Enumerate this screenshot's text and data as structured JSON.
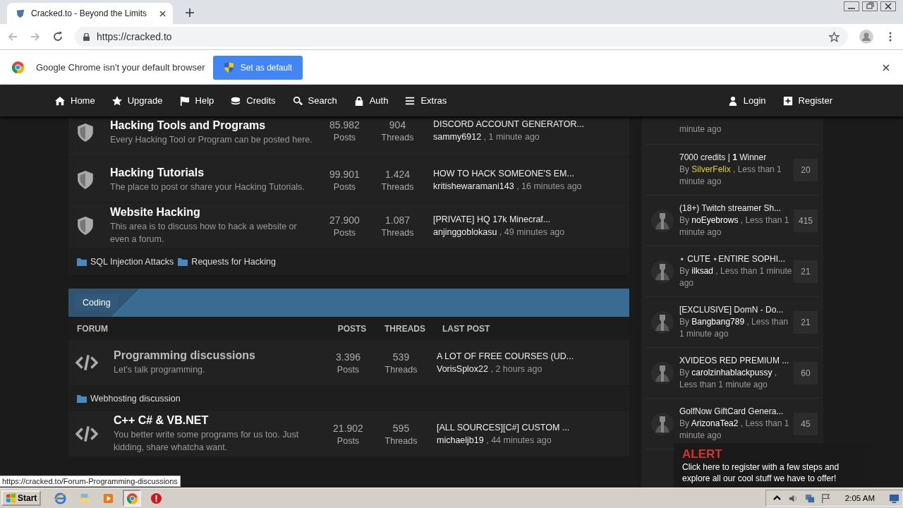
{
  "browser": {
    "tab_title": "Cracked.to - Beyond the Limits",
    "url": "https://cracked.to"
  },
  "infobar": {
    "message": "Google Chrome isn't your default browser",
    "button": "Set as default"
  },
  "nav": {
    "left": [
      "Home",
      "Upgrade",
      "Help",
      "Credits",
      "Search",
      "Auth",
      "Extras"
    ],
    "right": [
      "Login",
      "Register"
    ]
  },
  "sections": [
    {
      "rows": [
        {
          "kind": "shield",
          "title": "Hacking Tools and Programs",
          "description": "Every Hacking Tool or Program can be posted here.",
          "posts": "85.982",
          "posts_label": "Posts",
          "threads": "904",
          "threads_label": "Threads",
          "last_title": "DISCORD ACCOUNT GENERATOR...",
          "last_author": "sammy6912",
          "last_time": ", 1 minute ago",
          "hovered": false
        },
        {
          "kind": "shield",
          "title": "Hacking Tutorials",
          "description": "The place to post or share your Hacking Tutorials.",
          "posts": "99.901",
          "posts_label": "Posts",
          "threads": "1.424",
          "threads_label": "Threads",
          "last_title": "HOW TO HACK SOMEONE'S EM...",
          "last_author": "kritishewaramani143",
          "last_time": ", 16 minutes ago",
          "hovered": false
        },
        {
          "kind": "shield",
          "title": "Website Hacking",
          "description": "This area is to discuss how to hack a website or even a forum.",
          "posts": "27.900",
          "posts_label": "Posts",
          "threads": "1.087",
          "threads_label": "Threads",
          "last_title": "[PRIVATE] HQ 17k Minecraf...",
          "last_author": "anjinggoblokasu",
          "last_time": ", 49 minutes ago",
          "hovered": false
        }
      ],
      "subforums": [
        "SQL Injection Attacks",
        "Requests for Hacking"
      ]
    },
    {
      "category": "Coding",
      "columns": [
        "FORUM",
        "POSTS",
        "THREADS",
        "LAST POST"
      ],
      "rows": [
        {
          "kind": "code",
          "title": "Programming discussions",
          "description": "Let's talk programming.",
          "posts": "3.396",
          "posts_label": "Posts",
          "threads": "539",
          "threads_label": "Threads",
          "last_title": "A LOT OF FREE COURSES (UD...",
          "last_author": "VorisSplox22",
          "last_time": ", 2 hours ago",
          "hovered": true
        }
      ],
      "subforums": [
        "Webhosting discussion"
      ]
    },
    {
      "rows": [
        {
          "kind": "code",
          "title": "C++ C# & VB.NET",
          "description": "You better write some programs for us too. Just kidding, share whatcha want.",
          "posts": "21.902",
          "posts_label": "Posts",
          "threads": "595",
          "threads_label": "Threads",
          "last_title": "[ALL SOURCES][C#] CUSTOM ...",
          "last_author": "michaeljb19",
          "last_time": ", 44 minutes ago",
          "hovered": false
        }
      ]
    }
  ],
  "sidebar": {
    "fragment": "minute ago",
    "items": [
      {
        "title": "7000 credits | **1** Winner",
        "by": "By",
        "author": "SilverFelix",
        "color": "#e6d229",
        "time": ", Less than 1 minute ago",
        "count": "20",
        "avatar": false
      },
      {
        "title": "(18+) Twitch streamer Sh...",
        "by": "By",
        "author": "noEyebrows",
        "color": "#ffffff",
        "time": ", Less than 1 minute ago",
        "count": "415",
        "avatar": true
      },
      {
        "title": "⋆ CUTE ⋆ENTIRE SOPHI...",
        "by": "By",
        "author": "ilksad",
        "color": "#ffffff",
        "time": ", Less than 1 minute ago",
        "count": "21",
        "avatar": true
      },
      {
        "title": "[EXCLUSIVE] DomN - Do...",
        "by": "By",
        "author": "Bangbang789",
        "color": "#ffffff",
        "time": ", Less than 1 minute ago",
        "count": "21",
        "avatar": true
      },
      {
        "title": "XVIDEOS RED PREMIUM ...",
        "by": "By",
        "author": "carolzinhablackpussy",
        "color": "#ffffff",
        "time": ", Less than 1 minute ago",
        "count": "60",
        "avatar": true
      },
      {
        "title": "GolfNow GiftCard Genera...",
        "by": "By",
        "author": "ArizonaTea2",
        "color": "#ffffff",
        "time": ", Less than 1 minute ago",
        "count": "45",
        "avatar": true
      }
    ]
  },
  "alert": {
    "title": "ALERT",
    "text": "Click here to register with a few steps and explore all our cool stuff we have to offer!"
  },
  "status_url": "https://cracked.to/Forum-Programming-discussions",
  "taskbar": {
    "start": "Start",
    "apps": [
      {
        "kind": "ie",
        "selected": false
      },
      {
        "kind": "folder",
        "selected": false
      },
      {
        "kind": "media",
        "selected": false
      },
      {
        "kind": "chrome",
        "selected": true
      },
      {
        "kind": "stop",
        "selected": false
      }
    ],
    "time": "2:05 AM"
  }
}
